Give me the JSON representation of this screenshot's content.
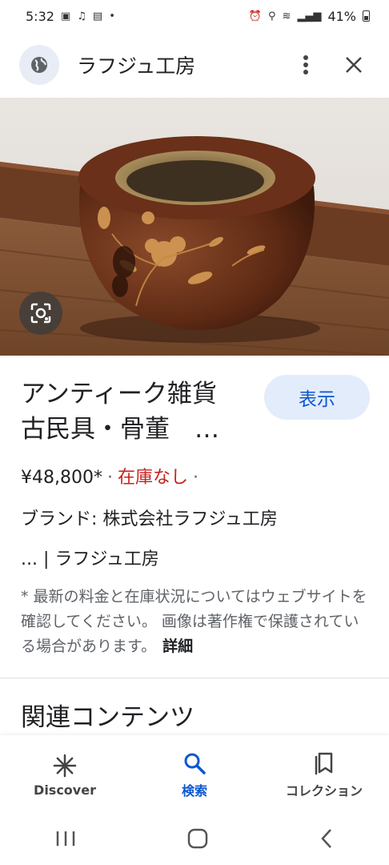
{
  "status_bar": {
    "time": "5:32",
    "battery": "41%",
    "dot": "•"
  },
  "app_bar": {
    "title": "ラフジュ工房"
  },
  "product": {
    "title_line1": "アンティーク雑貨",
    "title_line2": "古民具・骨董　…",
    "show_button": "表示",
    "price": "¥48,800*",
    "stock": "在庫なし",
    "separator": "·",
    "brand": "ブランド: 株式会社ラフジュ工房",
    "source": "... | ラフジュ工房",
    "disclaimer": "* 最新の料金と在庫状況についてはウェブサイトを確認してください。 画像は著作権で保護されている場合があります。",
    "details_link": "詳細"
  },
  "related": {
    "heading": "関連コンテンツ"
  },
  "bottom_nav": {
    "items": [
      {
        "label": "Discover",
        "icon": "asterisk-icon",
        "active": false
      },
      {
        "label": "検索",
        "icon": "search-icon",
        "active": true
      },
      {
        "label": "コレクション",
        "icon": "bookmarks-icon",
        "active": false
      }
    ]
  },
  "colors": {
    "accent": "#0b57d0",
    "out_of_stock": "#c5221f",
    "button_bg": "#e3ecfb"
  }
}
